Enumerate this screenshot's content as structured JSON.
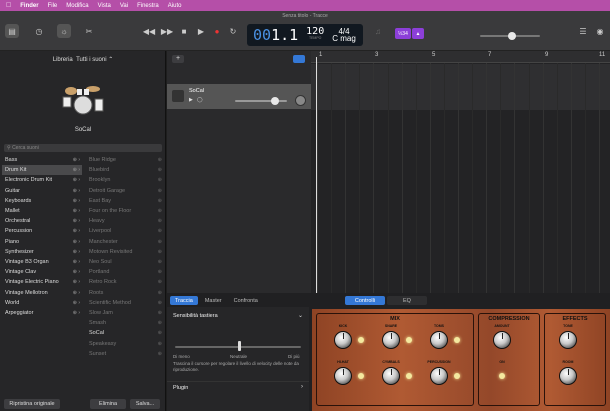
{
  "menubar": {
    "apple": "",
    "app": "Finder",
    "items": [
      "File",
      "Modifica",
      "Vista",
      "Vai",
      "Finestra",
      "Aiuto"
    ]
  },
  "window": {
    "title": "Senza titolo - Tracce"
  },
  "lcd": {
    "bar": "1",
    "beat_prefix": "00",
    "beat": "1",
    "bar_label": "BATTUTA",
    "beat_label": "BATTITO",
    "tempo": "120",
    "tempo_label": "TEMPO",
    "signature": "4/4",
    "key": "C mag"
  },
  "badges": {
    "count_in": "½34"
  },
  "library": {
    "title": "Libreria",
    "filter": "Tutti i suoni ⌃",
    "kit_name": "SoCal",
    "search_placeholder": "Cerca suoni",
    "categories": [
      "Bass",
      "Drum Kit",
      "Electronic Drum Kit",
      "Guitar",
      "Keyboards",
      "Mallet",
      "Orchestral",
      "Percussion",
      "Piano",
      "Synthesizer",
      "Vintage B3 Organ",
      "Vintage Clav",
      "Vintage Electric Piano",
      "Vintage Mellotron",
      "World",
      "Arpeggiator"
    ],
    "presets": [
      "Blue Ridge",
      "Bluebird",
      "Brooklyn",
      "Detroit Garage",
      "East Bay",
      "Four on the Floor",
      "Heavy",
      "Liverpool",
      "Manchester",
      "Motown Revisited",
      "Neo Soul",
      "Portland",
      "Retro Rock",
      "Roots",
      "Scientific Method",
      "Slow Jam",
      "Smash",
      "SoCal",
      "Speakeasy",
      "Sunset"
    ],
    "revert_button": "Ripristina originale",
    "delete_button": "Elimina",
    "save_button": "Salva..."
  },
  "track": {
    "name": "SoCal",
    "add_button": "+"
  },
  "ruler": {
    "marks": [
      "1",
      "3",
      "5",
      "7",
      "9",
      "11"
    ]
  },
  "bottom": {
    "tabs": [
      "Traccia",
      "Master",
      "Confronta"
    ],
    "tabs2": [
      "Controlli",
      "EQ"
    ],
    "sensitivity_title": "Sensibilità tastiera",
    "less": "Di meno",
    "neutral": "Neutrale",
    "more": "Di più",
    "hint": "Trascina il cursore per regolare il livello di velocity delle note da riproduzione.",
    "plugin": "Plugin"
  },
  "amp": {
    "mix": "MIX",
    "compression": "COMPRESSION",
    "effects": "EFFECTS",
    "mix_knobs": [
      "KICK",
      "SNARE",
      "TOMS",
      "HI-HAT",
      "CYMBALS",
      "PERCUSSION"
    ],
    "amount": "AMOUNT",
    "on": "ON",
    "tone": "TONE",
    "room": "ROOM"
  },
  "icons": [
    "library-icon",
    "smart-help-icon",
    "smart-controls-icon",
    "rewind-icon",
    "forward-icon",
    "stop-icon",
    "play-icon",
    "record-icon",
    "cycle-icon",
    "tuner-icon",
    "metronome-icon",
    "notepad-icon",
    "loops-icon"
  ]
}
